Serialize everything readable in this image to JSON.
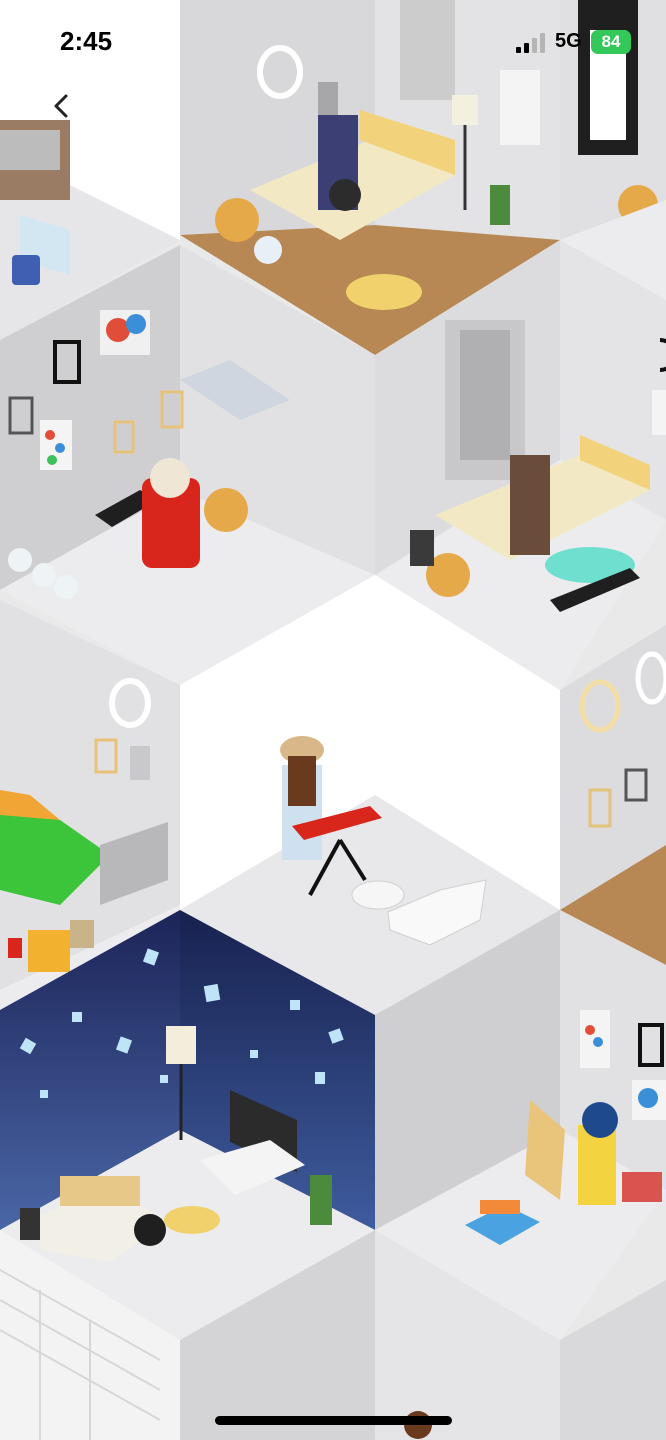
{
  "status_bar": {
    "time": "2:45",
    "network": "5G",
    "battery": "84"
  },
  "icons": {
    "back": "chevron-left-icon",
    "signal": "cellular-signal-icon",
    "battery": "battery-charging-icon"
  },
  "colors": {
    "wall_light": "#e2e2e4",
    "wall_mid": "#cfcfd2",
    "floor": "#ececee",
    "wood_floor": "#b58552",
    "night_wall": "#1e2a5e",
    "battery_green": "#34c759"
  }
}
